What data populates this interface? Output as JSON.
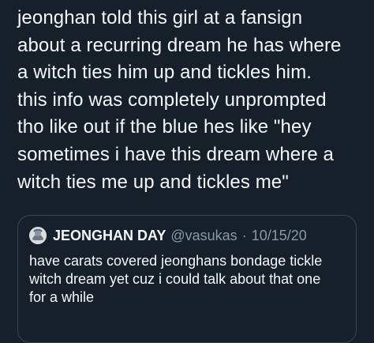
{
  "tweet": {
    "lines": [
      "jeonghan told this girl at a fansign",
      "about a recurring dream he has where",
      "a witch ties him up and tickles him.",
      "this info was completely unprompted",
      "tho like out if the blue hes like \"hey",
      "sometimes i have this dream where a",
      "witch ties me up and tickles me\""
    ]
  },
  "quote": {
    "avatar_icon": "avatar-icon",
    "name": "JEONGHAN DAY",
    "handle": "@vasukas",
    "separator": "·",
    "date": "10/15/20",
    "lines": [
      "have carats covered jeonghans bondage tickle",
      "witch dream yet cuz i could talk about that one",
      "for a while"
    ]
  },
  "colors": {
    "background": "#15202b",
    "text": "#f5f8fa",
    "secondary_text": "#8899a6",
    "border": "#38444d"
  }
}
